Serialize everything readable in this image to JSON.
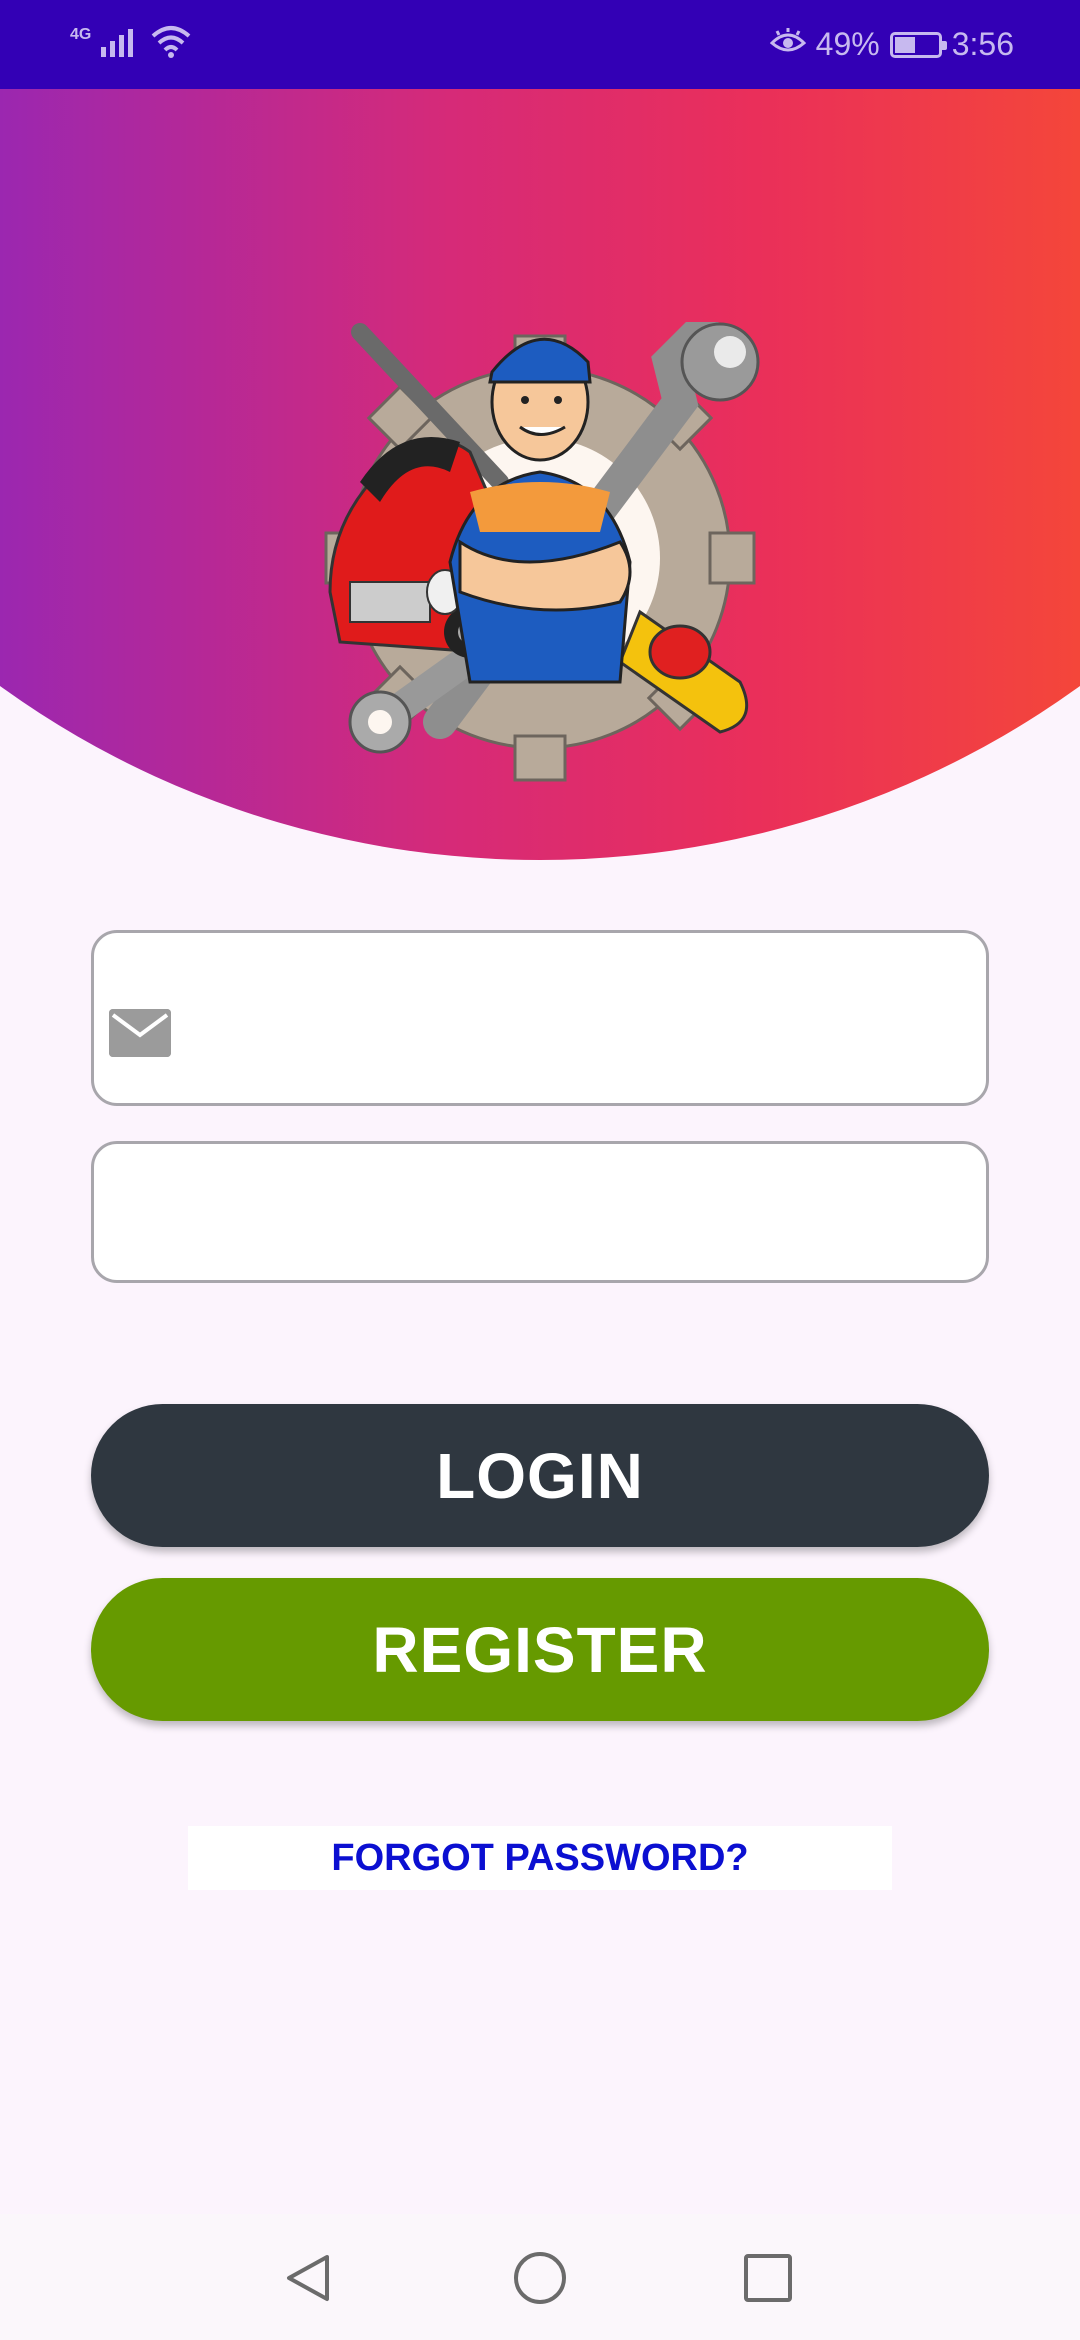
{
  "status_bar": {
    "network_type": "4G",
    "battery_percent": "49%",
    "battery_level": 0.49,
    "time": "3:56",
    "icons": [
      "signal-icon",
      "wifi-icon",
      "eye-comfort-icon",
      "battery-icon"
    ]
  },
  "header": {
    "logo": "mechanic-logo",
    "gradient_colors": [
      "#6d2fb8",
      "#9b27b0",
      "#d62a78",
      "#ea2f5a",
      "#f5502f"
    ]
  },
  "form": {
    "email": {
      "value": "",
      "placeholder": "",
      "icon": "mail-icon"
    },
    "password": {
      "value": "",
      "placeholder": ""
    }
  },
  "buttons": {
    "login_label": "LOGIN",
    "login_color": "#2f3740",
    "register_label": "REGISTER",
    "register_color": "#669a00"
  },
  "forgot_password_label": "FORGOT PASSWORD?",
  "link_color": "#0b0fd1",
  "nav_bar": {
    "buttons": [
      "back-icon",
      "home-icon",
      "recents-icon"
    ]
  }
}
